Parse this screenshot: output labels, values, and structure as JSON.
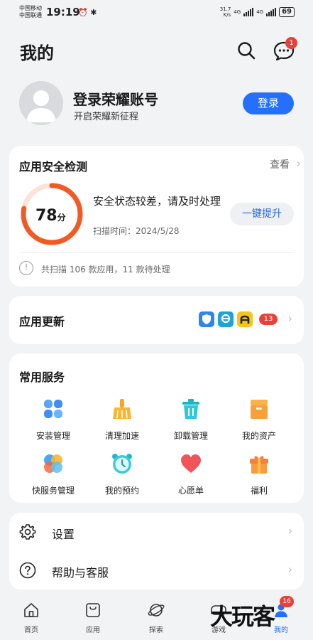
{
  "status_bar": {
    "carrier1": "中国移动",
    "carrier2": "中国联通",
    "time": "19:19",
    "net_speed_value": "31.7",
    "net_speed_unit": "K/s",
    "signal1": "4G",
    "signal2": "4G",
    "battery": "69"
  },
  "header": {
    "title": "我的",
    "message_badge": "1"
  },
  "account": {
    "title": "登录荣耀账号",
    "subtitle": "开启荣耀新征程",
    "login_label": "登录"
  },
  "security": {
    "title": "应用安全检测",
    "view_label": "查看",
    "score": "78",
    "score_unit": "分",
    "score_fraction": 0.78,
    "status": "安全状态较差，请及时处理",
    "scan_time": "扫描时间：2024/5/28",
    "boost_label": "一键提升",
    "summary": "共扫描 106 款应用，11 款待处理"
  },
  "updates": {
    "title": "应用更新",
    "count": "13"
  },
  "services": {
    "title": "常用服务",
    "items": [
      {
        "label": "安装管理",
        "icon": "install-manage-icon"
      },
      {
        "label": "清理加速",
        "icon": "cleanup-broom-icon"
      },
      {
        "label": "卸载管理",
        "icon": "uninstall-trash-icon"
      },
      {
        "label": "我的资产",
        "icon": "assets-box-icon"
      },
      {
        "label": "快服务管理",
        "icon": "quick-service-icon"
      },
      {
        "label": "我的预约",
        "icon": "alarm-clock-icon"
      },
      {
        "label": "心愿单",
        "icon": "heart-icon"
      },
      {
        "label": "福利",
        "icon": "gift-icon"
      }
    ]
  },
  "menu": {
    "settings": "设置",
    "help": "帮助与客服"
  },
  "nav": {
    "items": [
      {
        "label": "首页"
      },
      {
        "label": "应用"
      },
      {
        "label": "探索"
      },
      {
        "label": "游戏"
      },
      {
        "label": "我的"
      }
    ],
    "badge": "16"
  },
  "watermark": "大玩客",
  "colors": {
    "accent": "#256fff",
    "badge": "#e8413a",
    "gauge": "#f25a23",
    "background": "#f1f3f5"
  }
}
